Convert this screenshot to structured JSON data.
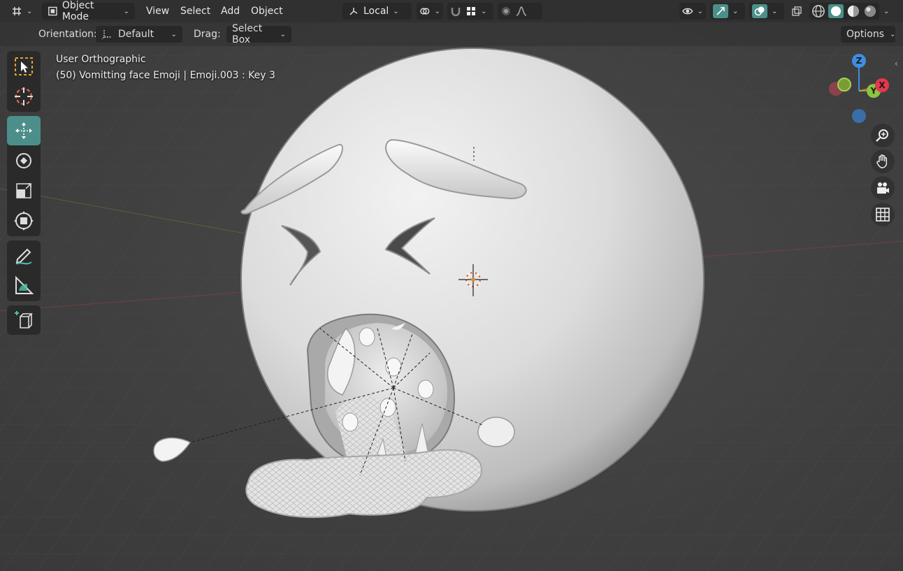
{
  "header": {
    "mode_label": "Object Mode",
    "menus": [
      "View",
      "Select",
      "Add",
      "Object"
    ],
    "transform_orientation": "Local",
    "options_label": "Options"
  },
  "tool_settings": {
    "orientation_label": "Orientation:",
    "orientation_value": "Default",
    "drag_label": "Drag:",
    "drag_value": "Select Box"
  },
  "viewport": {
    "view_name": "User Orthographic",
    "object_info": "(50) Vomitting face Emoji | Emoji.003 : Key 3"
  },
  "gizmo": {
    "axes": [
      "Z",
      "Y",
      "X"
    ],
    "colors": {
      "x": "#e5374f",
      "y": "#8bc43f",
      "z": "#3d8ee0"
    }
  },
  "toolbar": {
    "tools": [
      "select-box",
      "cursor",
      "move",
      "rotate",
      "scale",
      "transform",
      "annotate",
      "measure",
      "add-cube"
    ],
    "active": "move"
  },
  "colors": {
    "accent": "#4c8f8a",
    "header_bg": "#303030",
    "panel_bg": "#282828"
  }
}
